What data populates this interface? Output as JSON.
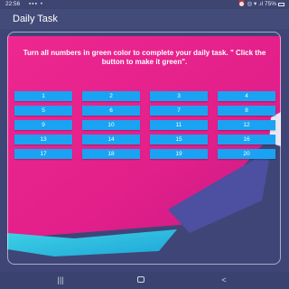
{
  "status_bar": {
    "time": "22:56",
    "notification_icons": "▪▪▪ •",
    "right_text": "⏰ ◎ ▾ .ıl 75%"
  },
  "app_bar": {
    "title": "Daily Task"
  },
  "instruction": "Turn all numbers in green color to complete your daily task. \" Click the button to make it green\".",
  "buttons": [
    {
      "label": "1"
    },
    {
      "label": "2"
    },
    {
      "label": "3"
    },
    {
      "label": "4"
    },
    {
      "label": "5"
    },
    {
      "label": "6"
    },
    {
      "label": "7"
    },
    {
      "label": "8"
    },
    {
      "label": "9"
    },
    {
      "label": "10"
    },
    {
      "label": "11"
    },
    {
      "label": "12"
    },
    {
      "label": "13"
    },
    {
      "label": "14"
    },
    {
      "label": "15"
    },
    {
      "label": "16"
    },
    {
      "label": "17"
    },
    {
      "label": "18"
    },
    {
      "label": "19"
    },
    {
      "label": "20"
    }
  ],
  "nav_bar": {
    "recent_glyph": "|||",
    "back_glyph": "<"
  },
  "colors": {
    "button": "#1aa3f2",
    "magenta": "#ec1f8c",
    "background": "#3f4677"
  }
}
